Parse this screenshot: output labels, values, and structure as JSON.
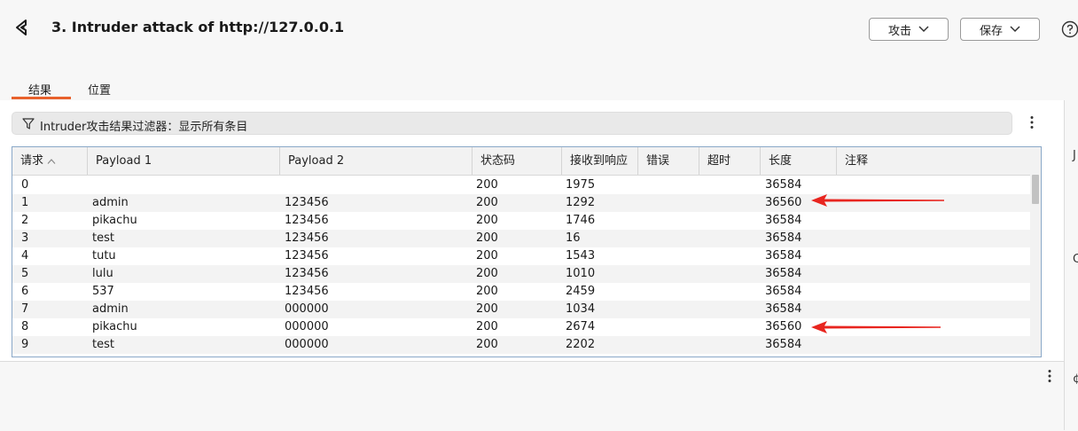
{
  "header": {
    "title": "3. Intruder attack of http://127.0.0.1",
    "attack_label": "攻击",
    "save_label": "保存"
  },
  "tabs": [
    {
      "label": "结果",
      "active": true
    },
    {
      "label": "位置",
      "active": false
    }
  ],
  "filter": {
    "text": "Intruder攻击结果过滤器：显示所有条目"
  },
  "table": {
    "columns": [
      "请求",
      "Payload 1",
      "Payload 2",
      "状态码",
      "接收到响应",
      "错误",
      "超时",
      "长度",
      "注释"
    ],
    "sorted_column": "请求",
    "rows": [
      {
        "request": "0",
        "payload1": "",
        "payload2": "",
        "status": "200",
        "response": "1975",
        "error": "",
        "timeout": "",
        "length": "36584",
        "comment": ""
      },
      {
        "request": "1",
        "payload1": "admin",
        "payload2": "123456",
        "status": "200",
        "response": "1292",
        "error": "",
        "timeout": "",
        "length": "36560",
        "comment": ""
      },
      {
        "request": "2",
        "payload1": "pikachu",
        "payload2": "123456",
        "status": "200",
        "response": "1746",
        "error": "",
        "timeout": "",
        "length": "36584",
        "comment": ""
      },
      {
        "request": "3",
        "payload1": "test",
        "payload2": "123456",
        "status": "200",
        "response": "16",
        "error": "",
        "timeout": "",
        "length": "36584",
        "comment": ""
      },
      {
        "request": "4",
        "payload1": "tutu",
        "payload2": "123456",
        "status": "200",
        "response": "1543",
        "error": "",
        "timeout": "",
        "length": "36584",
        "comment": ""
      },
      {
        "request": "5",
        "payload1": "lulu",
        "payload2": "123456",
        "status": "200",
        "response": "1010",
        "error": "",
        "timeout": "",
        "length": "36584",
        "comment": ""
      },
      {
        "request": "6",
        "payload1": "537",
        "payload2": "123456",
        "status": "200",
        "response": "2459",
        "error": "",
        "timeout": "",
        "length": "36584",
        "comment": ""
      },
      {
        "request": "7",
        "payload1": "admin",
        "payload2": "000000",
        "status": "200",
        "response": "1034",
        "error": "",
        "timeout": "",
        "length": "36584",
        "comment": ""
      },
      {
        "request": "8",
        "payload1": "pikachu",
        "payload2": "000000",
        "status": "200",
        "response": "2674",
        "error": "",
        "timeout": "",
        "length": "36560",
        "comment": ""
      },
      {
        "request": "9",
        "payload1": "test",
        "payload2": "000000",
        "status": "200",
        "response": "2202",
        "error": "",
        "timeout": "",
        "length": "36584",
        "comment": ""
      }
    ]
  },
  "annotations": {
    "arrow_color": "#e8251f",
    "highlighted_rows": [
      "1",
      "8"
    ]
  },
  "right_edge_glyphs": [
    "J",
    "C",
    "¢"
  ],
  "colors": {
    "tab_accent": "#e8612c",
    "table_border": "#8aa8c8"
  }
}
